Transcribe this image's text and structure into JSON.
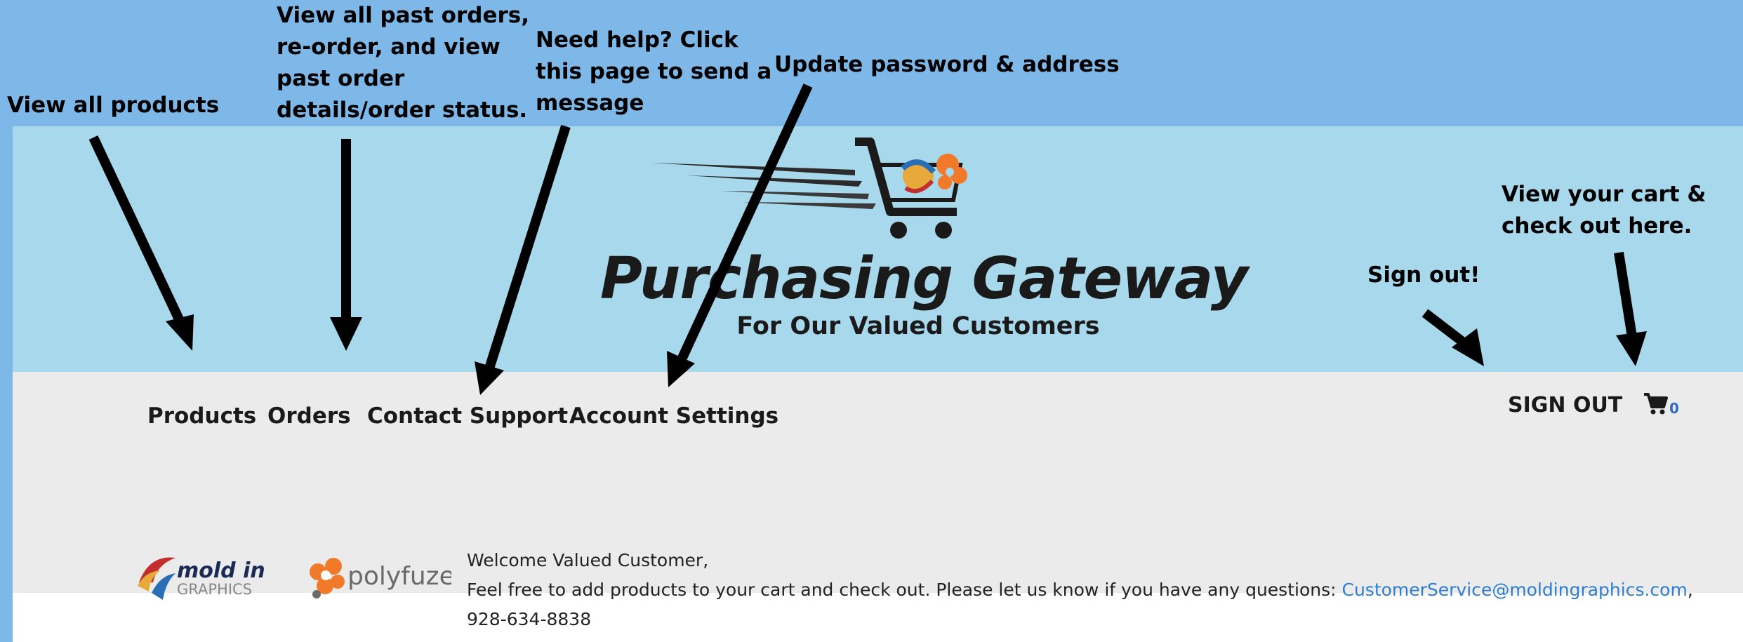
{
  "annotations": {
    "products": "View all products",
    "orders_lines": [
      "View all past orders,",
      "re-order, and view",
      "past order",
      "details/order status."
    ],
    "support_lines": [
      "Need help? Click",
      "this page to send a",
      "message"
    ],
    "account": "Update password & address",
    "signout": "Sign out!",
    "cart_lines": [
      "View your cart &",
      "check out here."
    ]
  },
  "header": {
    "title": "Purchasing Gateway",
    "subtitle": "For Our Valued Customers"
  },
  "nav": {
    "products": "Products",
    "orders": "Orders",
    "contact_support": "Contact Support",
    "account_settings": "Account Settings",
    "sign_out": "SIGN OUT",
    "cart_count": "0"
  },
  "brands": {
    "moldin_line1": "mold in",
    "moldin_line2": "GRAPHICS",
    "polyfuze": "polyfuze"
  },
  "welcome": {
    "line1": "Welcome Valued Customer,",
    "line2": "Feel free to add products to your cart and check out. Please let us know if you have any questions:",
    "email": "CustomerService@moldingraphics.com",
    "comma": ",",
    "phone": "928-634-8838"
  },
  "colors": {
    "outer_bg": "#7db8e8",
    "header_bg": "#a8d8ec",
    "nav_bg": "#ebebeb",
    "link": "#2e7dd1",
    "brand_orange": "#f07a2a"
  }
}
